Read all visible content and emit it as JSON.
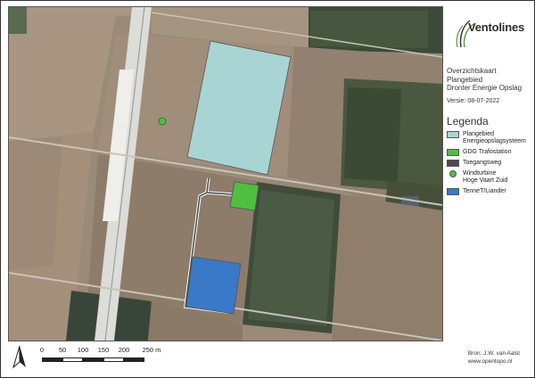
{
  "logo": {
    "name": "Ventolines"
  },
  "title": {
    "lines": [
      "Overzichtskaart",
      "Plangebied",
      "Dronter Energie Opslag"
    ],
    "version": "Versie: 08-07-2022"
  },
  "legend": {
    "title": "Legenda",
    "items": [
      {
        "lines": [
          "Plangebied",
          "Energieopslagsysteem"
        ],
        "color": "#a8d4d4",
        "shape": "rect"
      },
      {
        "lines": [
          "GDG Trafostation"
        ],
        "color": "#4fbf3f",
        "shape": "rect"
      },
      {
        "lines": [
          "Toegangsweg"
        ],
        "color": "#4a4a4a",
        "shape": "rect"
      },
      {
        "lines": [
          "Windturbine",
          "Hoge Vaart Zuid"
        ],
        "color": "#4fbf3f",
        "shape": "circle"
      },
      {
        "lines": [
          "TenneT/Liander"
        ],
        "color": "#3a78c8",
        "shape": "rect"
      }
    ]
  },
  "scale": {
    "labels": [
      "0",
      "50",
      "100",
      "150",
      "200",
      "250 m"
    ]
  },
  "source": {
    "lines": [
      "Bron: J.W. van Aalst",
      "www.opentopo.nl"
    ]
  },
  "map_colors": {
    "plangebied": "#a8d4d4",
    "trafostation": "#4fbf3f",
    "tennet": "#3a78c8",
    "turbine": "#4fbf3f",
    "road": "#4a4a4a"
  }
}
